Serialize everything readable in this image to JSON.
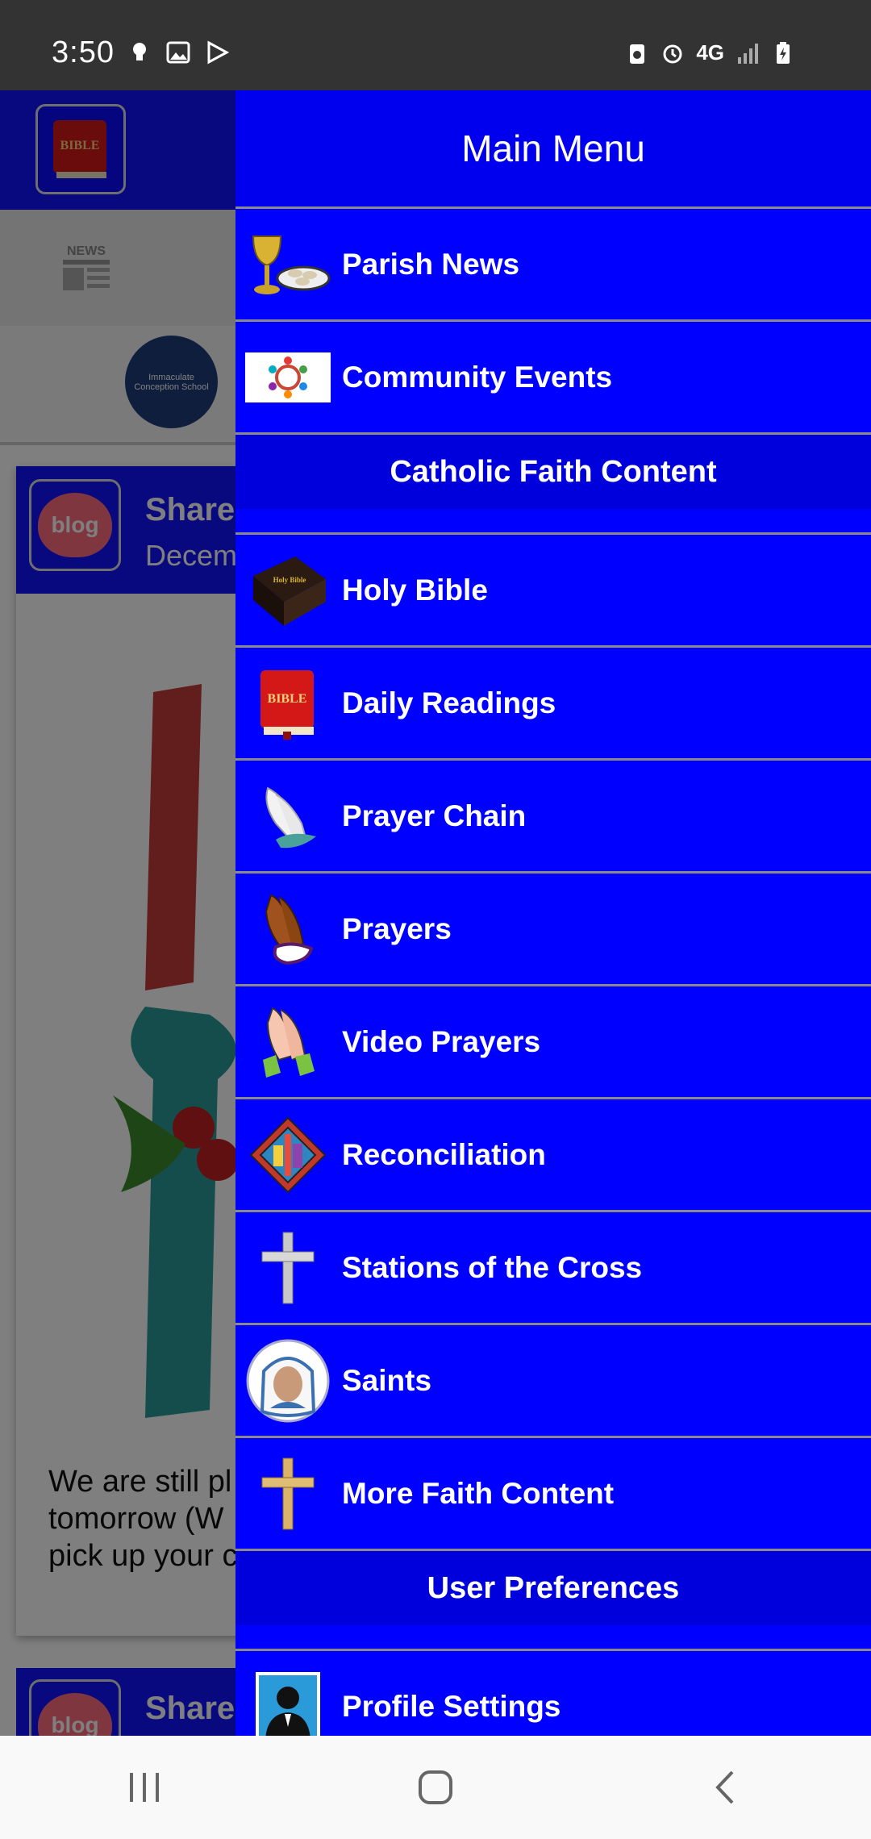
{
  "status_bar": {
    "time": "3:50",
    "left_icons": [
      "bulb-icon",
      "image-icon",
      "play-store-icon"
    ],
    "right_icons": [
      "recycle-icon",
      "alarm-icon",
      "network-4g-icon",
      "signal-icon",
      "battery-charging-icon"
    ],
    "network_label": "4G"
  },
  "background_app": {
    "logo_label": "BIBLE",
    "news_tab_label": "NEWS",
    "school_seal_text": "Immaculate Conception School",
    "post1": {
      "title": "Shared",
      "date": "Decem",
      "text": "We are still pl\ntomorrow (W\npick up your c"
    },
    "post2": {
      "title": "Shared"
    },
    "blog_label": "blog"
  },
  "drawer": {
    "title": "Main Menu",
    "items_top": [
      {
        "label": "Parish News",
        "icon": "chalice-icon"
      },
      {
        "label": "Community Events",
        "icon": "community-icon"
      }
    ],
    "section_faith": "Catholic Faith Content",
    "items_faith": [
      {
        "label": "Holy Bible",
        "icon": "holy-bible-icon"
      },
      {
        "label": "Daily Readings",
        "icon": "bible-red-icon"
      },
      {
        "label": "Prayer Chain",
        "icon": "praying-hands-light-icon"
      },
      {
        "label": "Prayers",
        "icon": "praying-hands-icon"
      },
      {
        "label": "Video Prayers",
        "icon": "praying-hands-video-icon"
      },
      {
        "label": "Reconciliation",
        "icon": "stained-glass-icon"
      },
      {
        "label": "Stations of the Cross",
        "icon": "silver-cross-icon"
      },
      {
        "label": "Saints",
        "icon": "saint-portrait-icon"
      },
      {
        "label": "More Faith Content",
        "icon": "gold-cross-icon"
      }
    ],
    "section_prefs": "User Preferences",
    "items_prefs": [
      {
        "label": "Profile Settings",
        "icon": "profile-avatar-icon"
      }
    ]
  },
  "nav_bar": {
    "buttons": [
      "recent-apps-icon",
      "home-icon",
      "back-icon"
    ]
  }
}
